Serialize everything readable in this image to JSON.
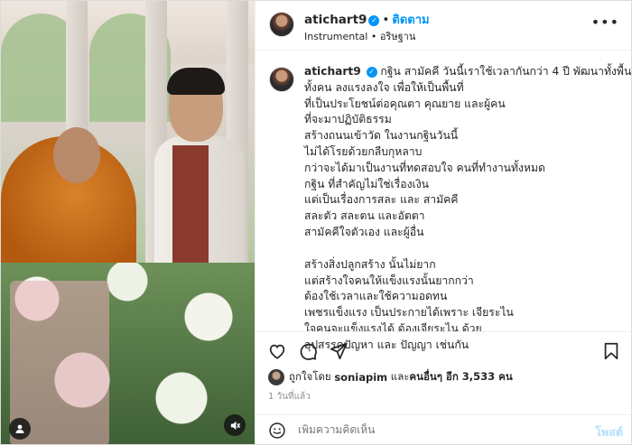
{
  "header": {
    "username": "atichart9",
    "follow_label": "ติดตาม",
    "dot": "•",
    "audio_label": "Instrumental",
    "audio_dot": "•",
    "location": "อริษฐาน",
    "more_label": "•••"
  },
  "caption": {
    "username": "atichart9",
    "lines": [
      "กฐิน สามัคคี วันนี้เราใช้เวลากันกว่า 4 ปี พัฒนาทั้งพื้นที่",
      "ทั้งคน ลงแรงลงใจ เพื่อให้เป็นพื้นที่",
      "ที่เป็นประโยชน์ต่อคุณตา คุณยาย และผู้คน",
      "ที่จะมาปฏิบัติธรรม",
      "สร้างถนนเข้าวัด ในงานกฐินวันนี้",
      "ไม่ได้โรยด้วยกลีบกุหลาบ",
      "กว่าจะได้มาเป็นงานที่ทดสอบใจ คนที่ทำงานทั้งหมด",
      "กฐิน ที่สำคัญไม่ใช่เรื่องเงิน",
      "แต่เป็นเรื่องการสละ และ สามัคคี",
      "สละตัว สละตน และอัตตา",
      "สามัคคีใจตัวเอง และผู้อื่น",
      "",
      "สร้างสิ่งปลูกสร้าง นั้นไม่ยาก",
      "แต่สร้างใจคนให้แข็งแรงนั้นยากกว่า",
      "ต้องใช้เวลาและใช้ความอดทน",
      "เพชรแข็งแรง เป็นประกายได้เพราะ เจียระไน",
      "ใจคนจะแข็งแรงได้ ต้องเจียระไน ด้วย",
      "อุปสรรคปัญหา และ ปัญญา เช่นกัน"
    ]
  },
  "likes": {
    "prefix": "ถูกใจโดย",
    "user": "soniapim",
    "middle": "และ",
    "others": "คนอื่นๆ อีก 3,533 คน"
  },
  "time": "1 วันที่แล้ว",
  "comment": {
    "placeholder": "เพิ่มความคิดเห็น",
    "post_label": "โพสต์"
  },
  "icons": {
    "like": "heart-icon",
    "comment": "comment-icon",
    "share": "paper-plane-icon",
    "save": "bookmark-icon",
    "emoji": "smiley-icon",
    "tag": "user-tag-icon",
    "mute": "speaker-muted-icon"
  },
  "colors": {
    "accent": "#0095f6",
    "post_disabled": "#b2dffc",
    "muted_text": "#8e8e8e"
  }
}
